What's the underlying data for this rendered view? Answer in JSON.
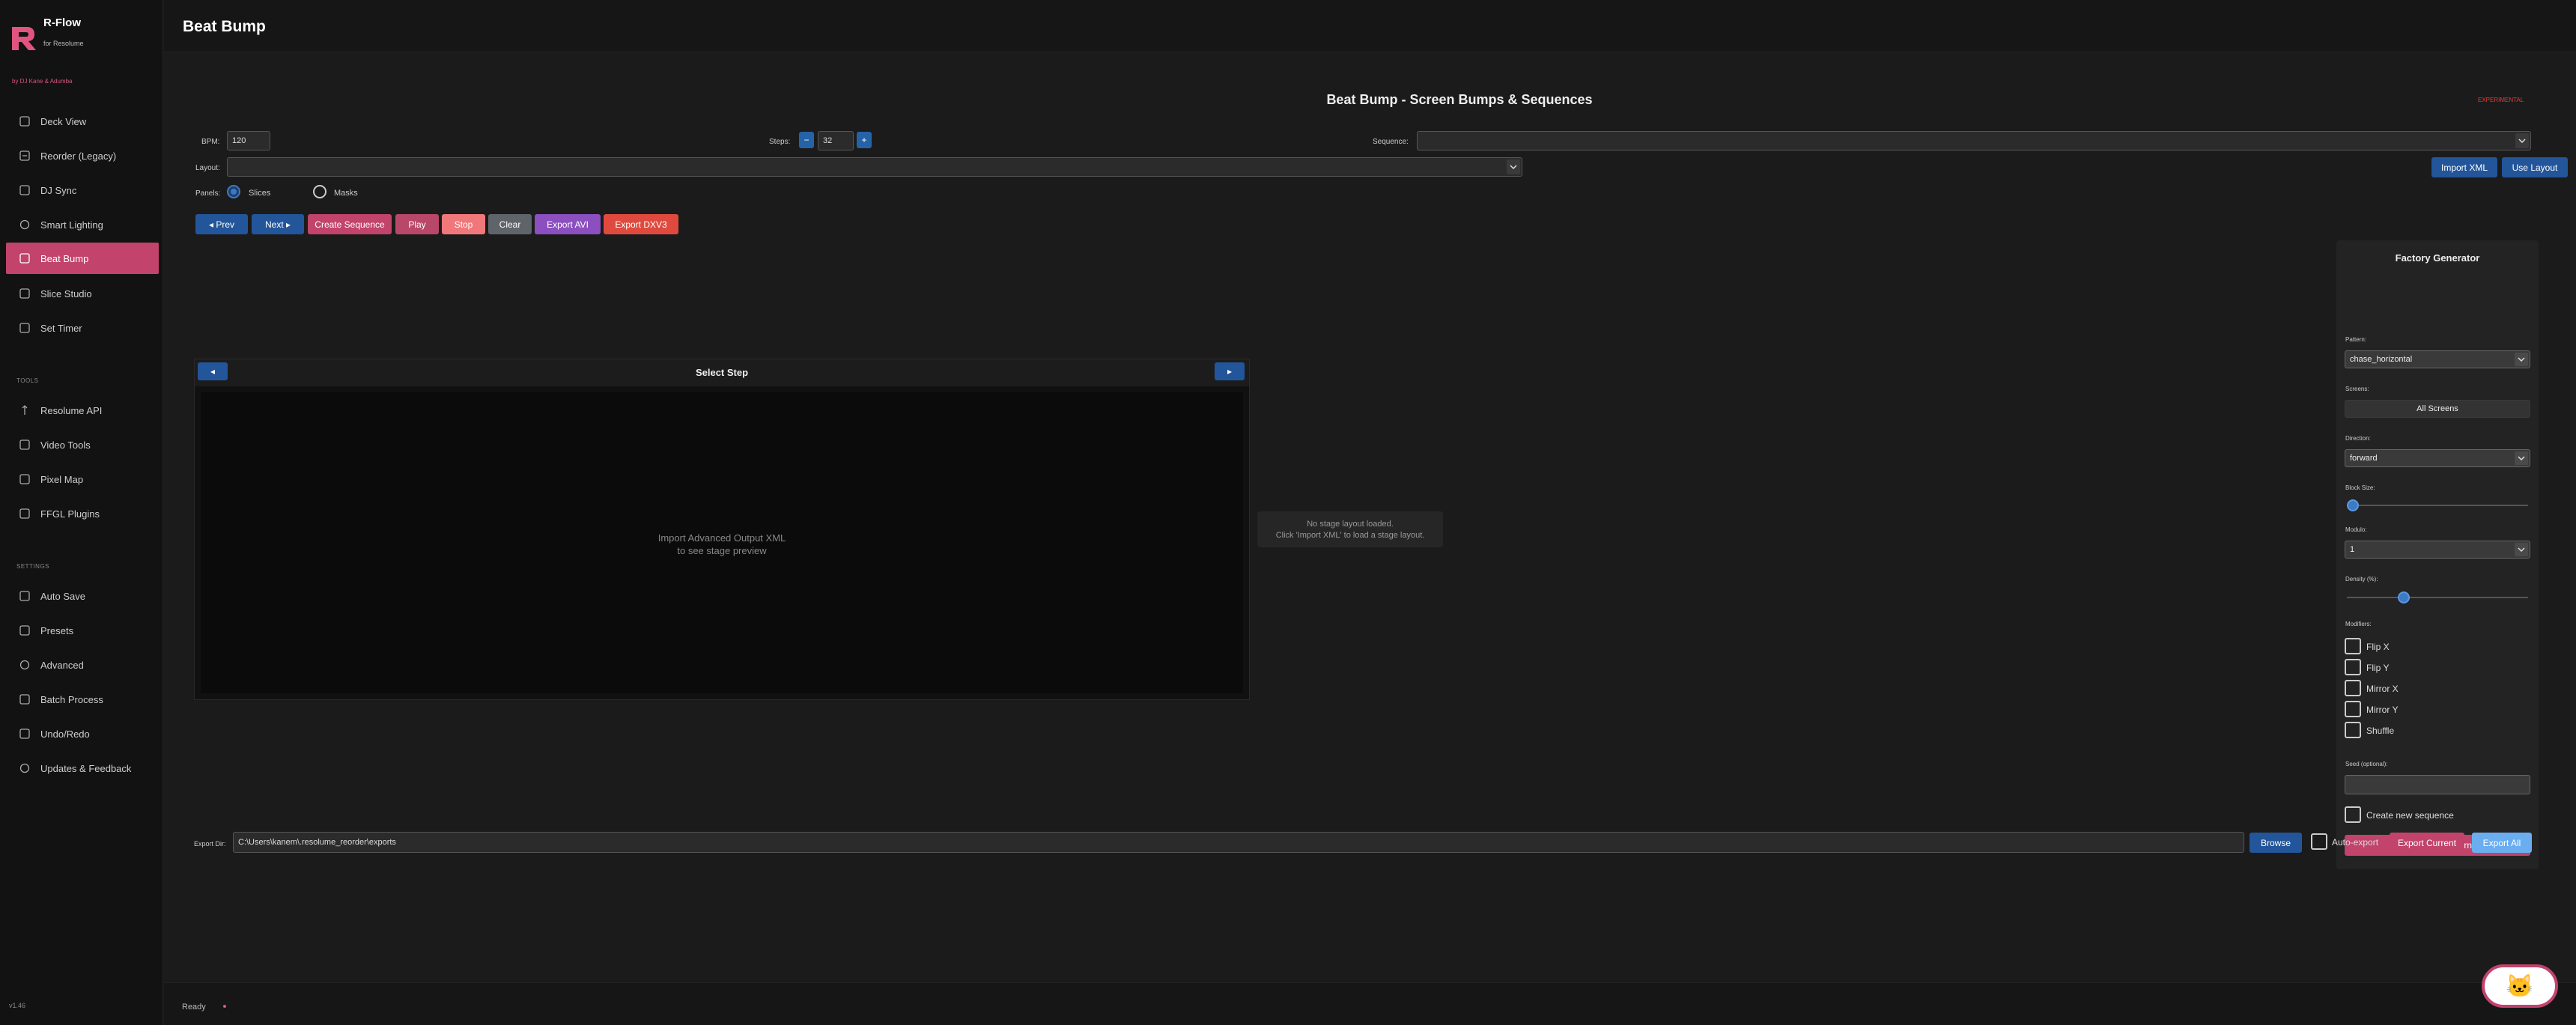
{
  "sidebar": {
    "brand": {
      "title": "R-Flow",
      "subtitle": "for Resolume",
      "by": "by DJ Kane & Adumba"
    },
    "items": [
      {
        "label": "Deck View",
        "icon": "deck-view-icon"
      },
      {
        "label": "Reorder (Legacy)",
        "icon": "reorder-icon"
      },
      {
        "label": "DJ Sync",
        "icon": "dj-sync-icon"
      },
      {
        "label": "Smart Lighting",
        "icon": "lighting-icon"
      },
      {
        "label": "Beat Bump",
        "icon": "beat-bump-icon"
      },
      {
        "label": "Slice Studio",
        "icon": "slice-studio-icon"
      },
      {
        "label": "Set Timer",
        "icon": "timer-icon"
      }
    ],
    "tools_label": "TOOLS",
    "tools": [
      {
        "label": "Resolume API",
        "icon": "api-icon"
      },
      {
        "label": "Video Tools",
        "icon": "video-icon"
      },
      {
        "label": "Pixel Map",
        "icon": "pixel-map-icon"
      },
      {
        "label": "FFGL Plugins",
        "icon": "plugin-icon"
      }
    ],
    "settings_label": "SETTINGS",
    "settings": [
      {
        "label": "Auto Save",
        "icon": "save-icon"
      },
      {
        "label": "Presets",
        "icon": "presets-icon"
      },
      {
        "label": "Advanced",
        "icon": "advanced-icon"
      },
      {
        "label": "Batch Process",
        "icon": "batch-icon"
      },
      {
        "label": "Undo/Redo",
        "icon": "undo-icon"
      },
      {
        "label": "Updates & Feedback",
        "icon": "feedback-icon"
      }
    ],
    "version": "v1.46"
  },
  "header": {
    "title": "Beat Bump"
  },
  "main": {
    "panel_title": "Beat Bump - Screen Bumps & Sequences",
    "experimental": "EXPERIMENTAL",
    "bpm_label": "BPM:",
    "bpm_value": "120",
    "steps_label": "Steps:",
    "steps_value": "32",
    "steps_minus": "−",
    "steps_plus": "+",
    "sequence_label": "Sequence:",
    "layout_label": "Layout:",
    "import_xml": "Import XML",
    "use_layout": "Use Layout",
    "panels_label": "Panels:",
    "panels_options": [
      "Slices",
      "Masks"
    ],
    "buttons": {
      "prev": "◂ Prev",
      "next": "Next ▸",
      "create_sequence": "Create Sequence",
      "play": "Play",
      "stop": "Stop",
      "clear": "Clear",
      "export_avi": "Export AVI",
      "export_dxv3": "Export DXV3"
    },
    "preview": {
      "title": "Select Step",
      "prev": "◂",
      "next": "▸",
      "message_line1": "Import Advanced Output XML",
      "message_line2": "to see stage preview"
    },
    "stage_message_line1": "No stage layout loaded.",
    "stage_message_line2": "Click 'Import XML' to load a stage layout.",
    "export": {
      "label": "Export Dir:",
      "path": "C:\\Users\\kanem\\.resolume_reorder\\exports",
      "browse": "Browse",
      "auto_export": "Auto-export",
      "export_current": "Export Current",
      "export_all": "Export All"
    }
  },
  "factory": {
    "title": "Factory Generator",
    "pattern_label": "Pattern:",
    "pattern_value": "chase_horizontal",
    "screens_label": "Screens:",
    "screens_value": "All Screens",
    "direction_label": "Direction:",
    "direction_value": "forward",
    "block_size_label": "Block Size:",
    "block_size_fraction": 0.0,
    "modulo_label": "Modulo:",
    "modulo_value": "1",
    "density_label": "Density (%):",
    "density_fraction": 0.3,
    "modifiers_label": "Modifiers:",
    "modifiers": [
      "Flip X",
      "Flip Y",
      "Mirror X",
      "Mirror Y",
      "Shuffle"
    ],
    "seed_label": "Seed (optional):",
    "create_new": "Create new sequence",
    "generate": "Generate Pattern"
  },
  "status": {
    "text": "Ready"
  },
  "colors": {
    "accent": "#c2436c",
    "primary_blue": "#23559a"
  }
}
